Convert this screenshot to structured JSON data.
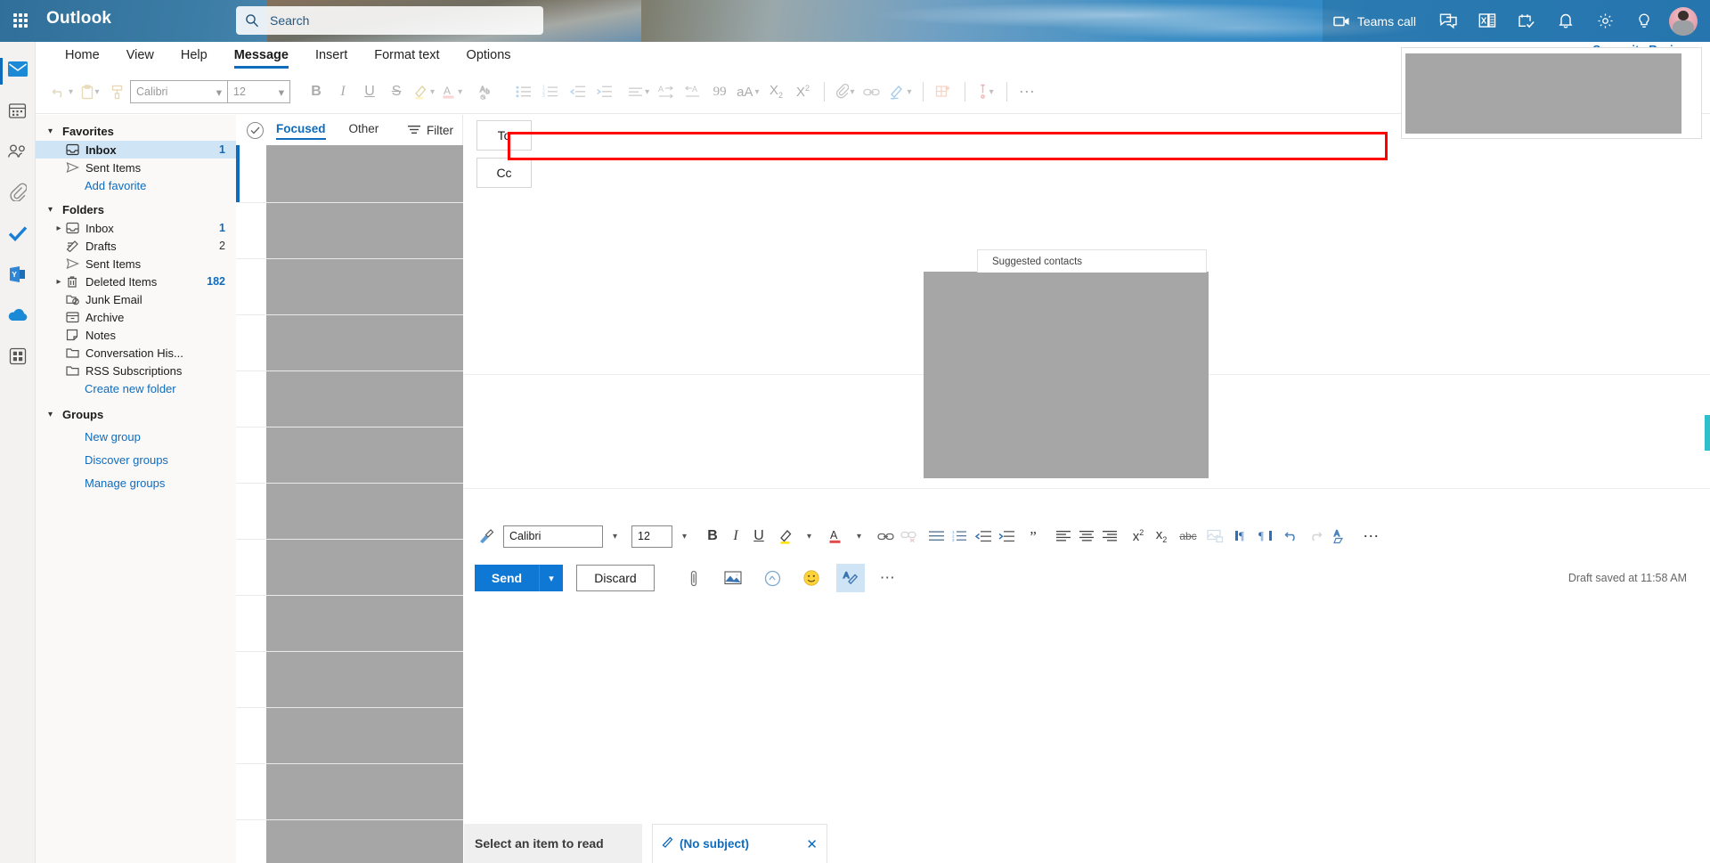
{
  "header": {
    "brand": "Outlook",
    "search_placeholder": "Search",
    "search_value": "",
    "teams_call_label": "Teams call",
    "icons": [
      {
        "name": "teams-call-icon",
        "label": "Teams call"
      },
      {
        "name": "chat-icon",
        "label": ""
      },
      {
        "name": "office-apps-icon",
        "label": ""
      },
      {
        "name": "calendar-checkmark-icon",
        "label": ""
      },
      {
        "name": "notification-bell-icon",
        "label": ""
      },
      {
        "name": "settings-gear-icon",
        "label": ""
      },
      {
        "name": "help-lightbulb-icon",
        "label": ""
      },
      {
        "name": "account-avatar",
        "label": ""
      }
    ],
    "waffle_label": "App launcher"
  },
  "app_rail": [
    {
      "name": "mail",
      "label": "Mail",
      "active": true
    },
    {
      "name": "calendar",
      "label": "Calendar",
      "active": false
    },
    {
      "name": "people",
      "label": "People",
      "active": false
    },
    {
      "name": "files",
      "label": "Files",
      "active": false
    },
    {
      "name": "to-do",
      "label": "To Do",
      "active": false
    },
    {
      "name": "yammer",
      "label": "Yammer",
      "active": false
    },
    {
      "name": "onedrive",
      "label": "OneDrive",
      "active": false
    },
    {
      "name": "all-apps",
      "label": "All apps",
      "active": false
    }
  ],
  "ribbon": {
    "tabs": [
      {
        "label": "Home",
        "active": false
      },
      {
        "label": "View",
        "active": false
      },
      {
        "label": "Help",
        "active": false
      },
      {
        "label": "Message",
        "active": true
      },
      {
        "label": "Insert",
        "active": false
      },
      {
        "label": "Format text",
        "active": false
      },
      {
        "label": "Options",
        "active": false
      }
    ],
    "font_name": "Calibri",
    "font_size": "12",
    "tools": [
      {
        "name": "undo-icon"
      },
      {
        "name": "paste-icon"
      },
      {
        "name": "format-painter-icon"
      },
      {
        "name": "bold-icon",
        "glyph": "B"
      },
      {
        "name": "italic-icon",
        "glyph": "I"
      },
      {
        "name": "underline-icon",
        "glyph": "U"
      },
      {
        "name": "strikethrough-icon",
        "glyph": "S"
      },
      {
        "name": "highlight-icon"
      },
      {
        "name": "font-color-icon",
        "glyph": "A"
      },
      {
        "name": "clear-formatting-icon"
      },
      {
        "name": "bulleted-list-icon"
      },
      {
        "name": "numbered-list-icon"
      },
      {
        "name": "decrease-indent-icon"
      },
      {
        "name": "increase-indent-icon"
      },
      {
        "name": "paragraph-align-icon"
      },
      {
        "name": "ltr-direction-icon"
      },
      {
        "name": "rtl-direction-icon"
      },
      {
        "name": "quote-icon",
        "glyph": "99"
      },
      {
        "name": "change-case-icon",
        "glyph": "aA"
      },
      {
        "name": "subscript-icon"
      },
      {
        "name": "superscript-icon"
      },
      {
        "name": "attach-icon"
      },
      {
        "name": "link-icon"
      },
      {
        "name": "signature-icon"
      },
      {
        "name": "apps-icon"
      },
      {
        "name": "importance-icon"
      },
      {
        "name": "more-options-icon",
        "glyph": "⋯"
      }
    ]
  },
  "sidebar": {
    "favorites_label": "Favorites",
    "favorites": [
      {
        "name": "inbox",
        "label": "Inbox",
        "count": "1",
        "icon": "inbox-icon",
        "selected": true,
        "expandable": false
      },
      {
        "name": "sent-items",
        "label": "Sent Items",
        "count": "",
        "icon": "sent-icon",
        "selected": false,
        "expandable": false
      }
    ],
    "add_favorite": "Add favorite",
    "folders_label": "Folders",
    "folders": [
      {
        "name": "inbox",
        "label": "Inbox",
        "count": "1",
        "icon": "inbox-icon",
        "expandable": true
      },
      {
        "name": "drafts",
        "label": "Drafts",
        "count": "2",
        "icon": "drafts-icon",
        "expandable": false,
        "plain_count": true
      },
      {
        "name": "sent-items",
        "label": "Sent Items",
        "count": "",
        "icon": "sent-icon",
        "expandable": false
      },
      {
        "name": "deleted-items",
        "label": "Deleted Items",
        "count": "182",
        "icon": "trash-icon",
        "expandable": true
      },
      {
        "name": "junk-email",
        "label": "Junk Email",
        "count": "",
        "icon": "junk-icon",
        "expandable": false
      },
      {
        "name": "archive",
        "label": "Archive",
        "count": "",
        "icon": "archive-icon",
        "expandable": false
      },
      {
        "name": "notes",
        "label": "Notes",
        "count": "",
        "icon": "notes-icon",
        "expandable": false
      },
      {
        "name": "conversation-history",
        "label": "Conversation His...",
        "count": "",
        "icon": "folder-icon",
        "expandable": false
      },
      {
        "name": "rss-subscriptions",
        "label": "RSS Subscriptions",
        "count": "",
        "icon": "folder-icon",
        "expandable": false
      }
    ],
    "create_new_folder": "Create new folder",
    "groups_label": "Groups",
    "group_links": [
      {
        "name": "new-group",
        "label": "New group"
      },
      {
        "name": "discover-groups",
        "label": "Discover groups"
      },
      {
        "name": "manage-groups",
        "label": "Manage groups"
      }
    ]
  },
  "message_list": {
    "focused_label": "Focused",
    "other_label": "Other",
    "filter_label": "Filter"
  },
  "compose": {
    "to_label": "To",
    "to_value": "",
    "cc_label": "Cc",
    "cc_value": "",
    "suggested_contacts_label": "Suggested contacts",
    "format_toolbar": {
      "font_name": "Calibri",
      "font_size": "12",
      "tools": [
        {
          "name": "format-painter-icon"
        },
        {
          "name": "bold-icon",
          "glyph": "B"
        },
        {
          "name": "italic-icon",
          "glyph": "I"
        },
        {
          "name": "underline-icon",
          "glyph": "U"
        },
        {
          "name": "highlight-icon"
        },
        {
          "name": "font-color-icon",
          "glyph": "A"
        },
        {
          "name": "insert-link-icon"
        },
        {
          "name": "remove-link-icon"
        },
        {
          "name": "bulleted-list-icon"
        },
        {
          "name": "numbered-list-icon"
        },
        {
          "name": "decrease-indent-icon"
        },
        {
          "name": "increase-indent-icon"
        },
        {
          "name": "quote-icon"
        },
        {
          "name": "align-left-icon"
        },
        {
          "name": "align-center-icon"
        },
        {
          "name": "align-right-icon"
        },
        {
          "name": "superscript-icon"
        },
        {
          "name": "subscript-icon"
        },
        {
          "name": "strikethrough-icon",
          "glyph": "abc"
        },
        {
          "name": "insert-picture-icon"
        },
        {
          "name": "ltr-paragraph-icon"
        },
        {
          "name": "rtl-paragraph-icon"
        },
        {
          "name": "undo-icon"
        },
        {
          "name": "redo-icon"
        },
        {
          "name": "clear-formatting-icon"
        },
        {
          "name": "more-formatting-icon",
          "glyph": "⋯"
        }
      ]
    },
    "send_label": "Send",
    "discard_label": "Discard",
    "action_icons": [
      {
        "name": "attach-file-icon"
      },
      {
        "name": "insert-picture-icon"
      },
      {
        "name": "insert-link-icon"
      },
      {
        "name": "emoji-icon"
      },
      {
        "name": "signature-icon",
        "active": true
      },
      {
        "name": "more-actions-icon",
        "glyph": "⋯"
      }
    ],
    "draft_saved": "Draft saved at 11:58 AM"
  },
  "bottom": {
    "select_item_label": "Select an item to read",
    "draft_tab_label": "(No subject)",
    "draft_tab_close": "✕"
  },
  "overlay": {
    "supervity_label": "Supervity Review"
  },
  "colors": {
    "accent": "#0f6cbd",
    "send_blue": "#0f78d4",
    "highlight_red": "#ff0000",
    "selected_row": "#cfe4f5",
    "placeholder_gray": "#a6a6a6"
  }
}
